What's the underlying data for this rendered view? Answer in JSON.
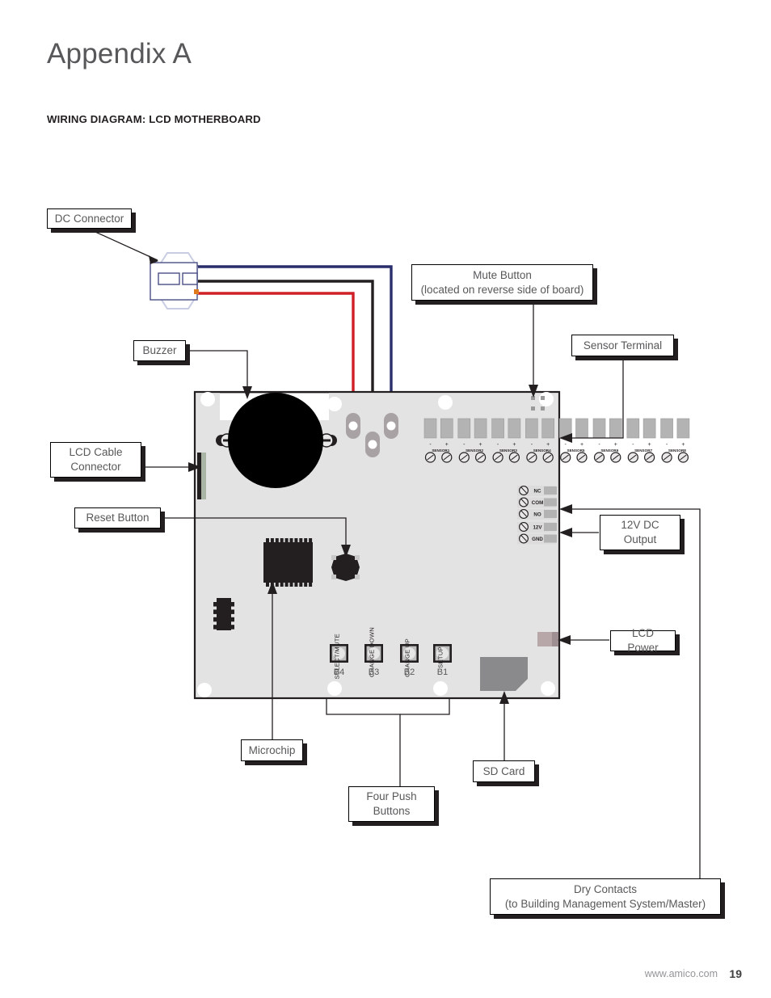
{
  "page": {
    "title": "Appendix A",
    "section_title": "WIRING DIAGRAM: LCD MOTHERBOARD",
    "footer_url": "www.amico.com",
    "footer_page": "19"
  },
  "colors": {
    "board_fill": "#e3e3e3",
    "board_stroke": "#231f20",
    "text_gray": "#58585a",
    "wire_blue": "#2a2f6b",
    "wire_black": "#231f20",
    "wire_red": "#cf2027",
    "connector_outline": "#4a4f86",
    "pad_gray": "#a9a2a4",
    "terminal_gray": "#b3b3b3",
    "sd_card": "#8a8a8c",
    "lcd_power": "#b7a7a9",
    "lcd_connector": "#a9b4a4",
    "ic_dark": "#231f20"
  },
  "callouts": [
    {
      "name": "dc-connector",
      "label": "DC Connector"
    },
    {
      "name": "mute-button",
      "label": "Mute Button\n(located on reverse side of board)"
    },
    {
      "name": "sensor-terminal",
      "label": "Sensor Terminal"
    },
    {
      "name": "buzzer",
      "label": "Buzzer"
    },
    {
      "name": "lcd-cable-connector",
      "label": "LCD Cable\nConnector"
    },
    {
      "name": "reset-button",
      "label": "Reset Button"
    },
    {
      "name": "12v-dc-output",
      "label": "12V DC\nOutput"
    },
    {
      "name": "lcd-power",
      "label": "LCD Power"
    },
    {
      "name": "microchip",
      "label": "Microchip"
    },
    {
      "name": "four-push-buttons",
      "label": "Four Push\nButtons"
    },
    {
      "name": "sd-card",
      "label": "SD Card"
    },
    {
      "name": "dry-contacts",
      "label": "Dry Contacts\n(to Building Management System/Master)"
    }
  ],
  "board": {
    "sensor_terminal": {
      "pin_signs": [
        "-",
        "+",
        "-",
        "+",
        "-",
        "+",
        "-",
        "+",
        "-",
        "+",
        "-",
        "+",
        "-",
        "+",
        "-",
        "+"
      ],
      "labels": [
        "SENSOR1",
        "SENSOR2",
        "SENSOR3",
        "SENSOR4",
        "SENSOR5",
        "SENSOR6",
        "SENSOR7",
        "SENSOR8"
      ]
    },
    "relay_terminal": {
      "labels": [
        "NC",
        "COM",
        "NO"
      ]
    },
    "power_terminal": {
      "labels": [
        "12V",
        "GND"
      ]
    },
    "push_buttons": [
      {
        "ref": "B4",
        "function": "SELECT/MUTE"
      },
      {
        "ref": "B3",
        "function": "CHANGE DOWN"
      },
      {
        "ref": "B2",
        "function": "CHANGE UP"
      },
      {
        "ref": "B1",
        "function": "SETUP"
      }
    ],
    "wires": [
      {
        "name": "blue-wire",
        "color": "#2a2f6b"
      },
      {
        "name": "black-wire",
        "color": "#231f20"
      },
      {
        "name": "red-wire",
        "color": "#cf2027"
      }
    ]
  }
}
